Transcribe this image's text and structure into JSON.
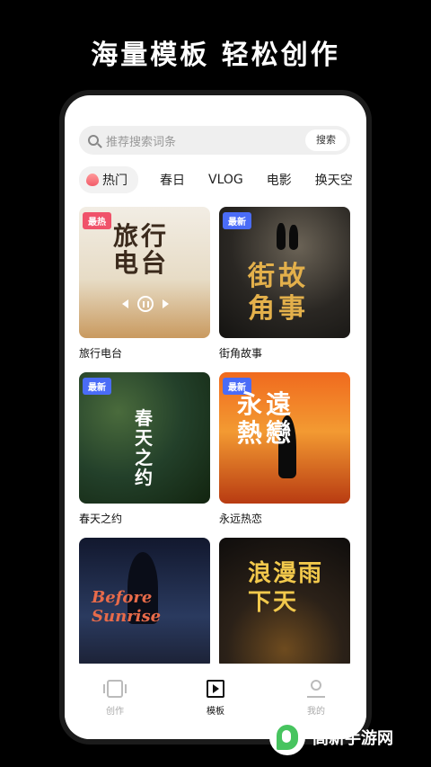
{
  "headline": "海量模板 轻松创作",
  "search": {
    "placeholder": "推荐搜索词条",
    "button": "搜索"
  },
  "tabs": [
    {
      "label": "热门",
      "icon": "fire-icon",
      "active": true
    },
    {
      "label": "春日"
    },
    {
      "label": "VLOG"
    },
    {
      "label": "电影"
    },
    {
      "label": "换天空"
    }
  ],
  "cards": [
    {
      "title": "旅行电台",
      "badge": "最热",
      "art": "旅行\n电台"
    },
    {
      "title": "街角故事",
      "badge": "最新",
      "art": "街故\n角事"
    },
    {
      "title": "春天之约",
      "badge": "最新",
      "art": "春天之约"
    },
    {
      "title": "永远热恋",
      "badge": "最新",
      "art": "永遠\n熱戀"
    },
    {
      "title": "",
      "badge": "",
      "art": "Before Sunrise"
    },
    {
      "title": "",
      "badge": "",
      "art": "浪漫雨\n下天"
    }
  ],
  "colors": {
    "hot_badge": "#f0526a",
    "new_badge": "#4a6cf7"
  },
  "bottom_nav": [
    {
      "label": "创作",
      "icon": "create-icon"
    },
    {
      "label": "模板",
      "icon": "template-icon",
      "active": true
    },
    {
      "label": "我的",
      "icon": "profile-icon"
    }
  ],
  "watermark": "高新手游网"
}
